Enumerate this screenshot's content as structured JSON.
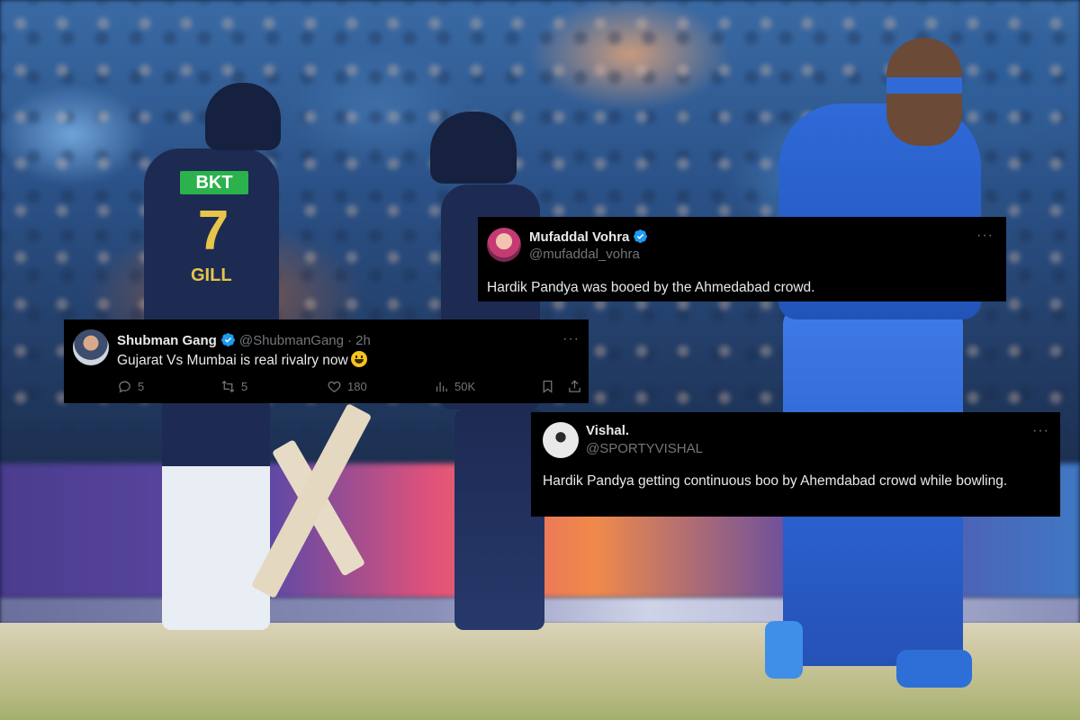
{
  "tweets": [
    {
      "id": "mufaddal",
      "name": "Mufaddal Vohra",
      "handle": "@mufaddal_vohra",
      "verified": true,
      "text": "Hardik Pandya was booed by the Ahmedabad crowd.",
      "more": "···"
    },
    {
      "id": "shubman-gang",
      "name": "Shubman Gang",
      "handle": "@ShubmanGang",
      "time": "· 2h",
      "verified": true,
      "text": "Gujarat Vs Mumbai is real rivalry now",
      "more": "···",
      "stats": {
        "replies": "5",
        "reposts": "5",
        "likes": "180",
        "views": "50K"
      }
    },
    {
      "id": "vishal",
      "name": "Vishal.",
      "handle": "@SPORTYVISHAL",
      "verified": false,
      "text": "Hardik Pandya getting continuous boo by Ahemdabad crowd while bowling.",
      "more": "···"
    }
  ],
  "photo": {
    "jersey_sponsor": "BKT",
    "jersey_number": "7",
    "jersey_name": "GILL"
  },
  "colors": {
    "card_bg": "#000000",
    "text_primary": "#e7e9ea",
    "text_secondary": "#71767b",
    "verified_blue": "#1d9bf0"
  },
  "icons": [
    "verified-badge-icon",
    "more-icon",
    "reply-icon",
    "repost-icon",
    "like-icon",
    "views-icon",
    "bookmark-icon",
    "share-icon",
    "smiley-emoji-icon"
  ]
}
